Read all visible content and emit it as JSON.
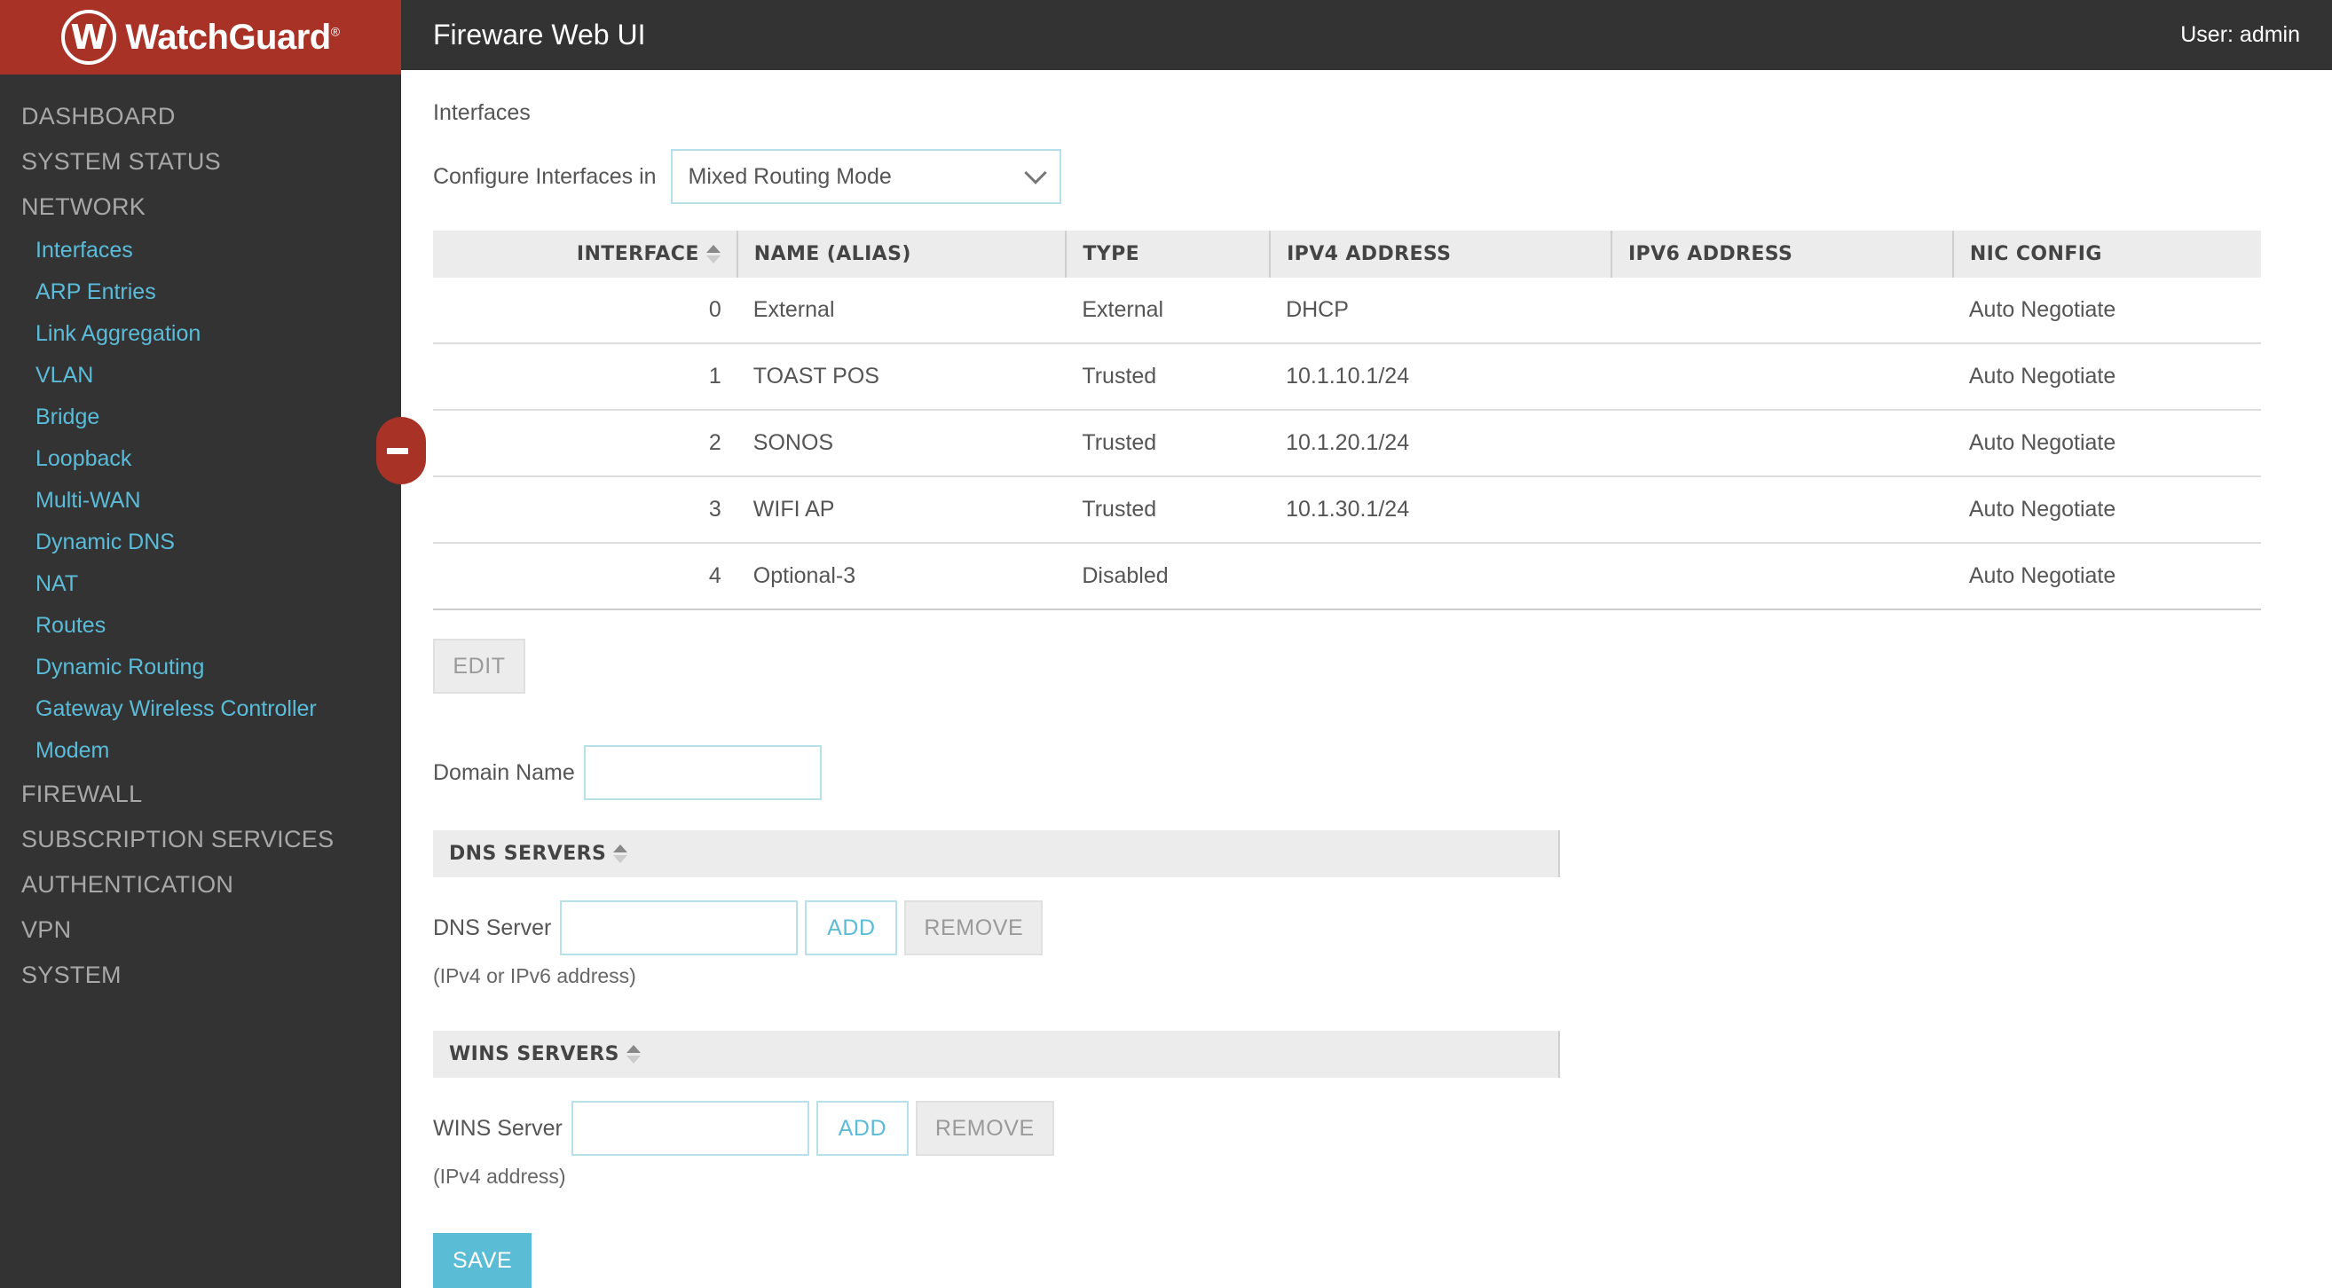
{
  "brand": {
    "logo_text": "WatchGuard",
    "logo_mark_letter": "W",
    "trademark": "®"
  },
  "header": {
    "title": "Fireware Web UI",
    "user_label": "User: admin"
  },
  "sidebar": {
    "collapse_handle_icon": "minus-icon",
    "items": [
      {
        "label": "DASHBOARD",
        "type": "section"
      },
      {
        "label": "SYSTEM STATUS",
        "type": "section"
      },
      {
        "label": "NETWORK",
        "type": "section"
      },
      {
        "label": "Interfaces",
        "type": "sub"
      },
      {
        "label": "ARP Entries",
        "type": "sub"
      },
      {
        "label": "Link Aggregation",
        "type": "sub"
      },
      {
        "label": "VLAN",
        "type": "sub"
      },
      {
        "label": "Bridge",
        "type": "sub"
      },
      {
        "label": "Loopback",
        "type": "sub"
      },
      {
        "label": "Multi-WAN",
        "type": "sub"
      },
      {
        "label": "Dynamic DNS",
        "type": "sub"
      },
      {
        "label": "NAT",
        "type": "sub"
      },
      {
        "label": "Routes",
        "type": "sub"
      },
      {
        "label": "Dynamic Routing",
        "type": "sub"
      },
      {
        "label": "Gateway Wireless Controller",
        "type": "sub"
      },
      {
        "label": "Modem",
        "type": "sub"
      },
      {
        "label": "FIREWALL",
        "type": "section"
      },
      {
        "label": "SUBSCRIPTION SERVICES",
        "type": "section"
      },
      {
        "label": "AUTHENTICATION",
        "type": "section"
      },
      {
        "label": "VPN",
        "type": "section"
      },
      {
        "label": "SYSTEM",
        "type": "section"
      }
    ]
  },
  "main": {
    "page_heading": "Interfaces",
    "configure": {
      "label": "Configure Interfaces in",
      "selected": "Mixed Routing Mode",
      "chevron_icon": "chevron-down-icon"
    },
    "table": {
      "columns": [
        "INTERFACE",
        "NAME (ALIAS)",
        "TYPE",
        "IPV4 ADDRESS",
        "IPV6 ADDRESS",
        "NIC CONFIG"
      ],
      "sort_column": "INTERFACE",
      "rows": [
        {
          "interface": "0",
          "name": "External",
          "type": "External",
          "ipv4": "DHCP",
          "ipv6": "",
          "nic": "Auto Negotiate"
        },
        {
          "interface": "1",
          "name": "TOAST POS",
          "type": "Trusted",
          "ipv4": "10.1.10.1/24",
          "ipv6": "",
          "nic": "Auto Negotiate"
        },
        {
          "interface": "2",
          "name": "SONOS",
          "type": "Trusted",
          "ipv4": "10.1.20.1/24",
          "ipv6": "",
          "nic": "Auto Negotiate"
        },
        {
          "interface": "3",
          "name": "WIFI AP",
          "type": "Trusted",
          "ipv4": "10.1.30.1/24",
          "ipv6": "",
          "nic": "Auto Negotiate"
        },
        {
          "interface": "4",
          "name": "Optional-3",
          "type": "Disabled",
          "ipv4": "",
          "ipv6": "",
          "nic": "Auto Negotiate"
        }
      ]
    },
    "edit_button": "EDIT",
    "domain": {
      "label": "Domain Name",
      "value": ""
    },
    "dns": {
      "section_title": "DNS SERVERS",
      "field_label": "DNS Server",
      "value": "",
      "add_label": "ADD",
      "remove_label": "REMOVE",
      "hint": "(IPv4 or IPv6 address)"
    },
    "wins": {
      "section_title": "WINS SERVERS",
      "field_label": "WINS Server",
      "value": "",
      "add_label": "ADD",
      "remove_label": "REMOVE",
      "hint": "(IPv4 address)"
    },
    "save_button": "SAVE"
  },
  "colors": {
    "brand_red": "#a93226",
    "sidebar_dark": "#333333",
    "link_blue": "#5bbcd9",
    "accent_teal": "#5bbcd5",
    "header_grey": "#ececec"
  }
}
